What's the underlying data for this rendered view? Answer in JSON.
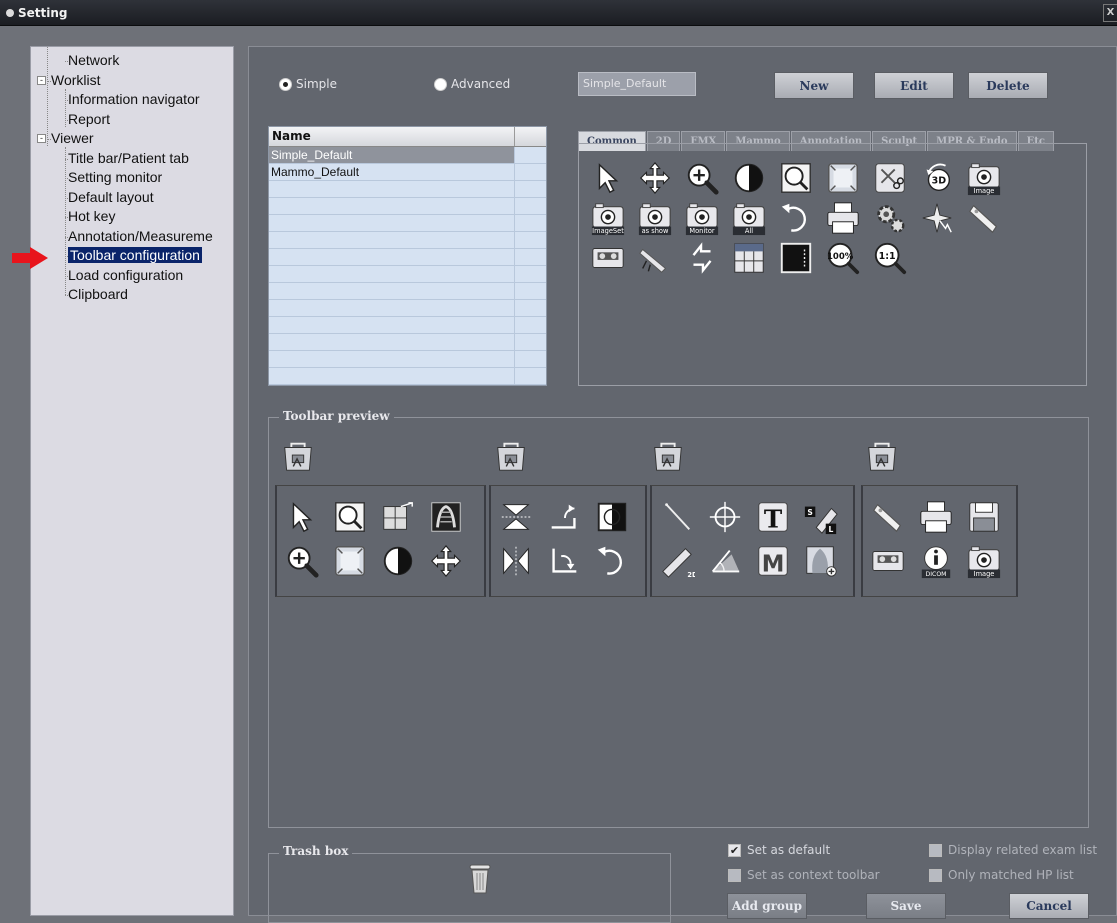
{
  "window": {
    "title": "Setting",
    "close_glyph": "X"
  },
  "tree": {
    "items": [
      {
        "label": "Network",
        "level": 1,
        "expander": ""
      },
      {
        "label": "Worklist",
        "level": 0,
        "expander": "-"
      },
      {
        "label": "Information navigator",
        "level": 1,
        "expander": ""
      },
      {
        "label": "Report",
        "level": 1,
        "expander": ""
      },
      {
        "label": "Viewer",
        "level": 0,
        "expander": "-"
      },
      {
        "label": "Title bar/Patient tab",
        "level": 1,
        "expander": ""
      },
      {
        "label": "Setting monitor",
        "level": 1,
        "expander": ""
      },
      {
        "label": "Default layout",
        "level": 1,
        "expander": ""
      },
      {
        "label": "Hot key",
        "level": 1,
        "expander": ""
      },
      {
        "label": "Annotation/Measureme",
        "level": 1,
        "expander": ""
      },
      {
        "label": "Toolbar configuration",
        "level": 1,
        "expander": "",
        "selected": true
      },
      {
        "label": "Load configuration",
        "level": 1,
        "expander": ""
      },
      {
        "label": "Clipboard",
        "level": 1,
        "expander": ""
      }
    ]
  },
  "mode": {
    "simple": "Simple",
    "advanced": "Advanced",
    "selected": "simple"
  },
  "name_field": {
    "value": "Simple_Default"
  },
  "buttons": {
    "new": "New",
    "edit": "Edit",
    "delete": "Delete",
    "add_group": "Add group",
    "save": "Save",
    "cancel": "Cancel"
  },
  "name_table": {
    "header": "Name",
    "rows": [
      "Simple_Default",
      "Mammo_Default"
    ],
    "selected_index": 0
  },
  "tabs": [
    "Common",
    "2D",
    "FMX",
    "Mammo",
    "Annotation",
    "Sculpt",
    "MPR & Endo",
    "Etc"
  ],
  "active_tab": "Common",
  "icon_captions": {
    "image": "Image",
    "imageset": "ImageSet",
    "asshow": "as show",
    "monitor": "Monitor",
    "all": "All",
    "zoom100": "100%",
    "zoom11": "1:1",
    "dicom": "DICOM",
    "t": "T",
    "m": "M",
    "d3": "3D",
    "d2": "2D",
    "s": "S",
    "l": "L"
  },
  "toolbar_preview": {
    "label": "Toolbar preview"
  },
  "trash": {
    "label": "Trash box"
  },
  "options": {
    "set_default": {
      "label": "Set as default",
      "checked": true
    },
    "set_context": {
      "label": "Set as context toolbar",
      "checked": false
    },
    "display_related": {
      "label": "Display related exam list",
      "checked": false
    },
    "only_matched": {
      "label": "Only matched HP list",
      "checked": false
    }
  },
  "colors": {
    "accent_selection": "#0a246a",
    "panel": "#62666e",
    "arrow": "#e8141c"
  }
}
